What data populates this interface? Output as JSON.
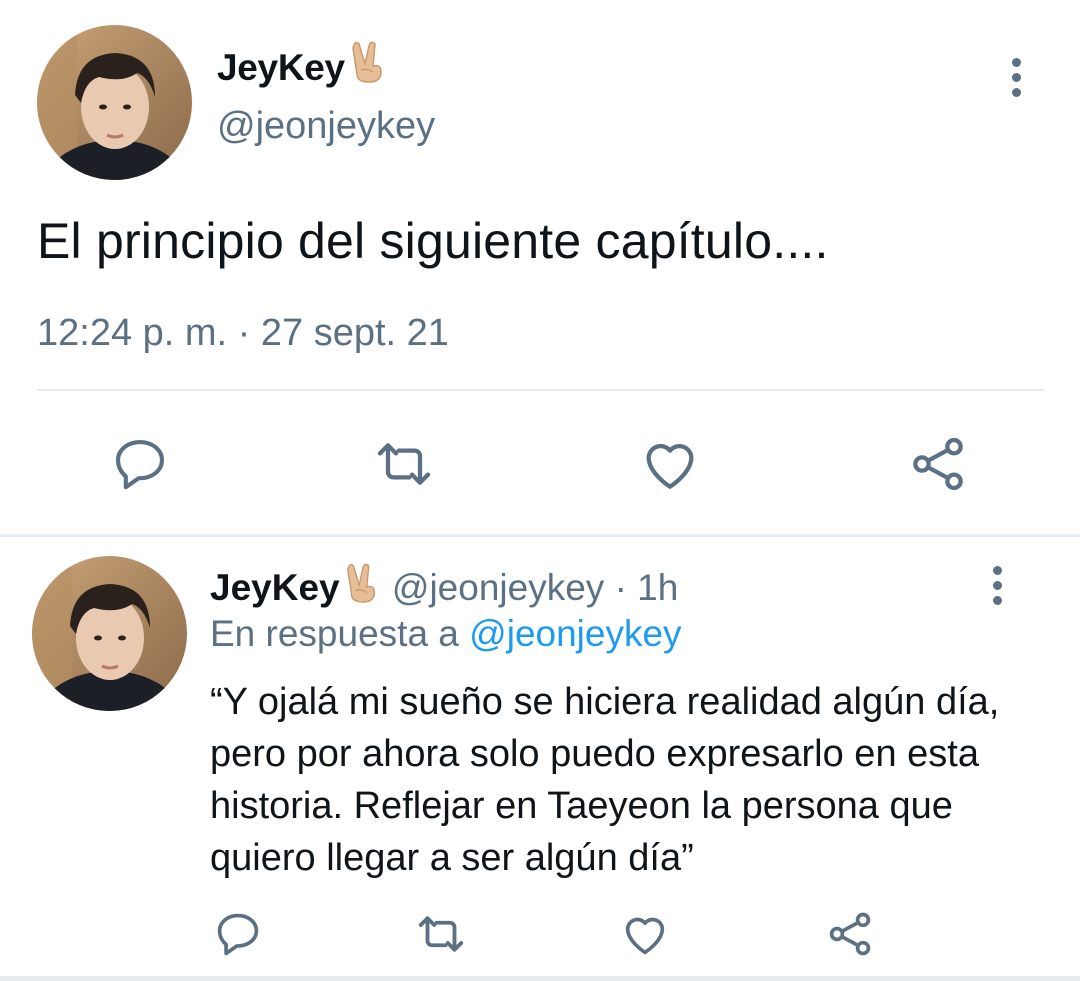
{
  "main_tweet": {
    "author_name": "JeyKey",
    "author_emoji": "✌🏼",
    "author_handle": "@jeonjeykey",
    "text": "El principio del siguiente capítulo....",
    "timestamp": "12:24 p. m. · 27 sept. 21",
    "actions": {
      "reply_icon": "reply-icon",
      "retweet_icon": "retweet-icon",
      "like_icon": "heart-icon",
      "share_icon": "share-icon"
    }
  },
  "reply_tweet": {
    "author_name": "JeyKey",
    "author_emoji": "✌🏼",
    "author_handle": "@jeonjeykey",
    "time_ago": "· 1h",
    "reply_prefix": "En respuesta a",
    "reply_mention": "@jeonjeykey",
    "text": "“Y ojalá mi sueño se hiciera realidad algún día, pero por ahora solo puedo expresarlo en esta historia. Reflejar en Taeyeon la persona que quiero llegar a ser algún día”"
  },
  "colors": {
    "text_primary": "#0f1419",
    "text_secondary": "#5b7083",
    "link": "#1d9bf0",
    "divider": "#e6ecf0"
  }
}
